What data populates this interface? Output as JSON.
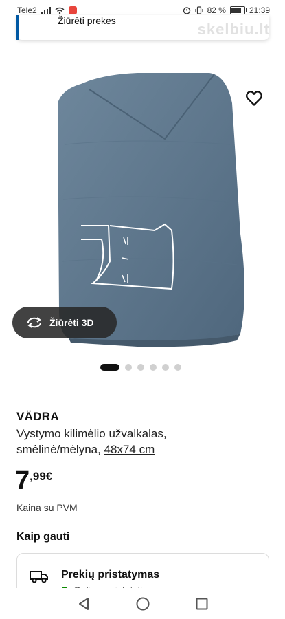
{
  "status_bar": {
    "carrier": "Tele2",
    "battery": "82 %",
    "time": "21:39"
  },
  "top_card": {
    "link_label": "Žiūrėti prekes"
  },
  "watermark": "skelbiu.lt",
  "product": {
    "name": "VÄDRA",
    "description": "Vystymo kilimėlio užvalkalas, smėlinė/mėlyna,",
    "size": "48x74 cm",
    "price_integer": "7",
    "price_decimal": ",99",
    "currency": "€",
    "vat_note": "Kaina su PVM",
    "view_3d_label": "Žiūrėti 3D",
    "image_count": 6,
    "active_image_index": 0
  },
  "how_to_get": {
    "heading": "Kaip gauti",
    "delivery_title": "Prekių pristatymas",
    "delivery_status": "Galima pristatyti"
  },
  "colors": {
    "accent": "#0058a3",
    "fabric": "#5f7a91",
    "stock_ok": "#0a8a00"
  },
  "icons": {
    "favorite": "heart-icon",
    "view_3d": "rotate-icon",
    "delivery": "truck-icon",
    "nav_back": "back-triangle-icon",
    "nav_home": "home-circle-icon",
    "nav_recent": "recent-square-icon"
  }
}
